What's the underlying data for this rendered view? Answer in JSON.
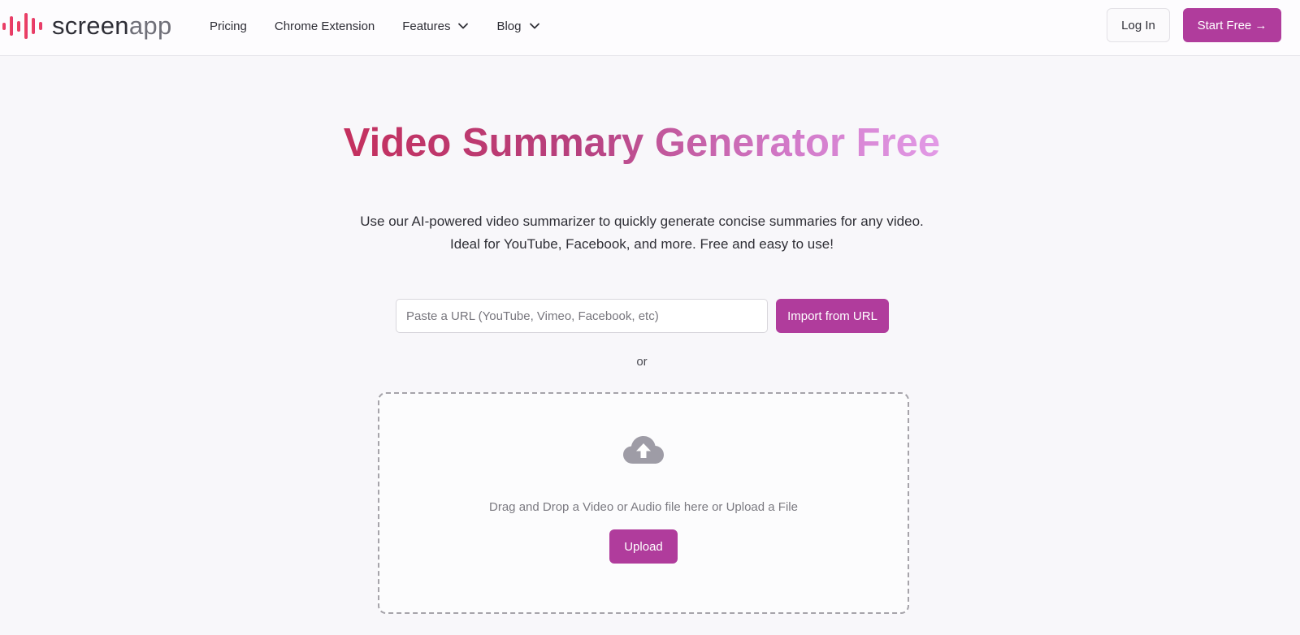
{
  "header": {
    "logo": {
      "part1": "screen",
      "part2": "app"
    },
    "nav": [
      {
        "label": "Pricing",
        "dropdown": false
      },
      {
        "label": "Chrome Extension",
        "dropdown": false
      },
      {
        "label": "Features",
        "dropdown": true
      },
      {
        "label": "Blog",
        "dropdown": true
      }
    ],
    "login_label": "Log In",
    "start_label": "Start Free →"
  },
  "hero": {
    "title": "Video Summary Generator Free",
    "subtitle_line1": "Use our AI-powered video summarizer to quickly generate concise summaries for any video.",
    "subtitle_line2": "Ideal for YouTube, Facebook, and more. Free and easy to use!"
  },
  "url_import": {
    "value": "",
    "placeholder": "Paste a URL (YouTube, Vimeo, Facebook, etc)",
    "button_label": "Import from URL"
  },
  "or_label": "or",
  "dropzone": {
    "icon": "cloud-upload-icon",
    "text": "Drag and Drop a Video or Audio file here or Upload a File",
    "button_label": "Upload"
  },
  "colors": {
    "accent": "#b03c9c",
    "title_gradient_start": "#c4305e",
    "title_gradient_end": "#e29ae6"
  }
}
